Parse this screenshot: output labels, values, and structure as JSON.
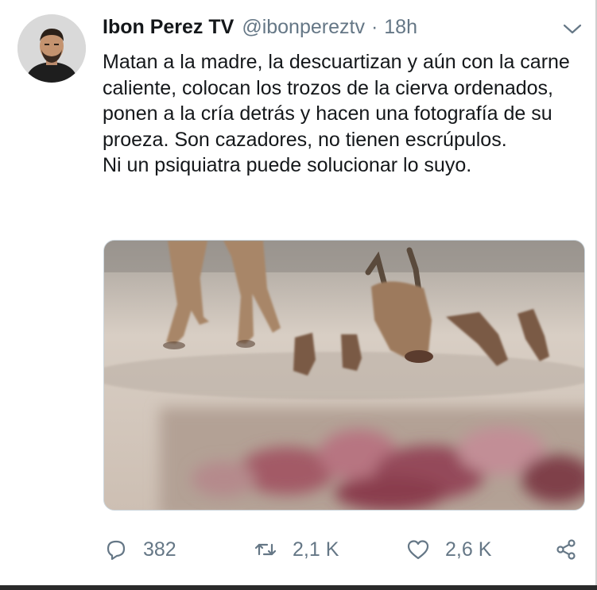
{
  "tweet": {
    "author_name": "Ibon Perez TV",
    "author_handle": "@ibonpereztv",
    "separator": "·",
    "time": "18h",
    "text_lines": [
      "Matan a la madre, la descuartizan y aún con la carne caliente, colocan los trozos de la cierva ordenados, ponen a la cría detrás  y hacen una fotografía de su proeza. Son cazadores, no tienen escrúpulos.",
      "Ni un psiquiatra puede solucionar lo suyo."
    ]
  },
  "actions": {
    "replies": "382",
    "retweets": "2,1 K",
    "likes": "2,6 K"
  },
  "icons": {
    "reply": "reply-icon",
    "retweet": "retweet-icon",
    "like": "heart-icon",
    "share": "share-icon",
    "menu": "chevron-down-icon"
  },
  "colors": {
    "text": "#14171a",
    "secondary": "#657786",
    "border": "#ccd6dd"
  }
}
